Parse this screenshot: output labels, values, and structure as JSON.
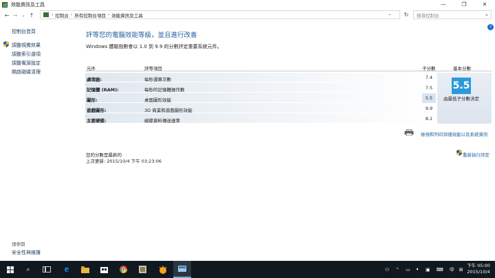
{
  "window": {
    "title": "效能資訊及工具",
    "minimize": "—",
    "maximize": "❐",
    "close": "✕"
  },
  "address": {
    "crumbs": [
      "控制台",
      "所有控制台項目",
      "效能資訊及工具"
    ],
    "search_placeholder": "搜尋控制台"
  },
  "sidebar": {
    "home": "控制台首頁",
    "items": [
      {
        "label": "調整視覺效果",
        "shield": true
      },
      {
        "label": "調整索引選項",
        "shield": false
      },
      {
        "label": "調整電源設定",
        "shield": false
      },
      {
        "label": "開啟磁碟清理",
        "shield": false
      }
    ],
    "see_also": "請參閱",
    "security": "安全性與維護"
  },
  "main": {
    "heading": "評等您的電腦效能等級，並且進行改善",
    "subtext": "Windows 體驗指數會以 1.0 到 9.9 的分數評定重要系統元件。",
    "table": {
      "headers": {
        "component": "元件",
        "rating": "評等項目",
        "subscore": "子分數",
        "basescore": "基本分數"
      },
      "rows": [
        {
          "component": "處理器:",
          "desc": "每秒運算次數",
          "score": "7.4"
        },
        {
          "component": "記憶體 (RAM):",
          "desc": "每秒的記憶體操作數",
          "score": "7.5"
        },
        {
          "component": "圖形:",
          "desc": "桌面圖形效能",
          "score": "5.5"
        },
        {
          "component": "遊戲圖形:",
          "desc": "3D 商業和遊戲圖形效能",
          "score": "9.9"
        },
        {
          "component": "主要硬碟:",
          "desc": "磁碟資料傳送速率",
          "score": "8.1"
        }
      ],
      "base_score": "5.5",
      "base_desc": "由最低子分數決定"
    },
    "print_link": "檢視和列印詳細效能以及系統資訊",
    "status_current": "您的分數是最新的",
    "last_update": "上次更新: 2015/10/4 下午 03:23:06",
    "rerun": "重新執行評定"
  },
  "taskbar": {
    "ime": "中",
    "clock_time": "下午 05:00",
    "clock_date": "2015/10/4",
    "colors": {
      "edge": "#1e90ff",
      "accent": "#2c9ad9"
    }
  }
}
